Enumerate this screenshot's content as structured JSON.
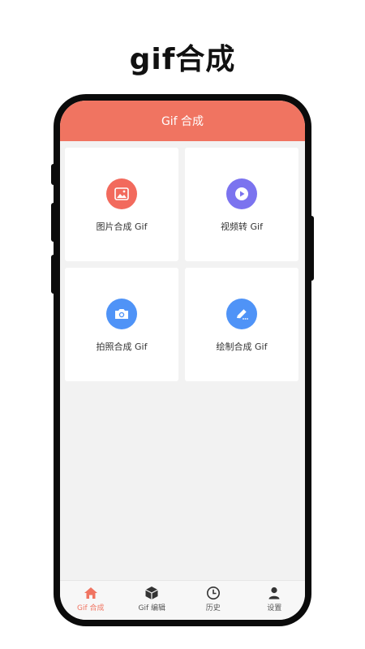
{
  "headline": "gif合成",
  "app": {
    "title": "Gif 合成"
  },
  "cards": [
    {
      "label": "图片合成 Gif",
      "icon": "image-icon",
      "color": "#f26a5d"
    },
    {
      "label": "视频转 Gif",
      "icon": "play-icon",
      "color": "#7b73ef"
    },
    {
      "label": "拍照合成 Gif",
      "icon": "camera-icon",
      "color": "#4f93f7"
    },
    {
      "label": "绘制合成 Gif",
      "icon": "pencil-icon",
      "color": "#4f93f7"
    }
  ],
  "tabs": [
    {
      "label": "Gif 合成",
      "icon": "home-icon",
      "active": true
    },
    {
      "label": "Gif 编辑",
      "icon": "cube-icon",
      "active": false
    },
    {
      "label": "历史",
      "icon": "clock-icon",
      "active": false
    },
    {
      "label": "设置",
      "icon": "person-icon",
      "active": false
    }
  ],
  "colors": {
    "accent": "#f07461",
    "background": "#f2f2f2"
  }
}
